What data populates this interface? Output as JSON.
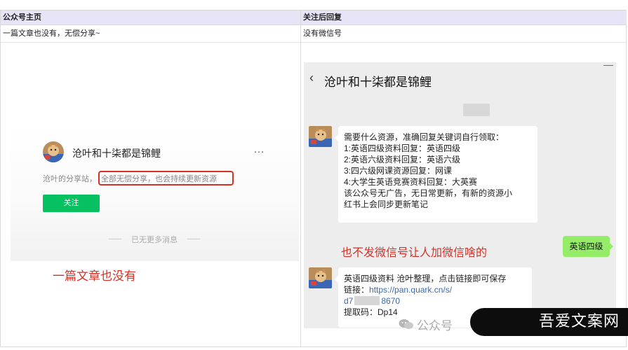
{
  "table": {
    "left_header": "公众号主页",
    "right_header": "关注后回复",
    "left_note": "一篇文章也没有，无偿分享~",
    "right_note": "没有微信号"
  },
  "profile": {
    "account_name": "沧叶和十柒都是锦鲤",
    "more_icon": "…",
    "description_prefix": "沧叶的分享站，",
    "description_highlight": "全部无偿分享，也会持续更新资源",
    "follow_button": "关注",
    "no_more": "已无更多消息",
    "annotation": "一篇文章也没有"
  },
  "chat": {
    "back_icon": "‹",
    "title": "沧叶和十柒都是锦鲤",
    "minimize": "—",
    "reply1_lines": [
      "需要什么资源，准确回复关键词自行领取：",
      "1:英语四级资料回复：英语四级",
      "2:英语六级资料回复：英语六级",
      "3:四六级网课资源回复：网课",
      "4:大学生英语竞赛资料回复：大英赛",
      "该公众号无广告，无日常更新，有新的资源小",
      "红书上会同步更新笔记"
    ],
    "user_message": "英语四级",
    "annotation": "也不发微信号让人加微信啥的",
    "reply2_line1": "英语四级资料 沧叶整理，点击链接即可保存",
    "reply2_link_label": "链接：",
    "reply2_link": "https://pan.quark.cn/s/",
    "reply2_code_prefix": "d7",
    "reply2_code_suffix": "8670",
    "reply2_extract": "提取码：Dp14"
  },
  "watermark": {
    "left_text": "公众号",
    "banner_text": "吾爱文案网"
  },
  "colors": {
    "header_bg": "#e8e4f8",
    "follow_green": "#07c160",
    "bubble_green": "#95ec69",
    "annotation_red": "#d93025",
    "link_blue": "#3b6aa8"
  }
}
